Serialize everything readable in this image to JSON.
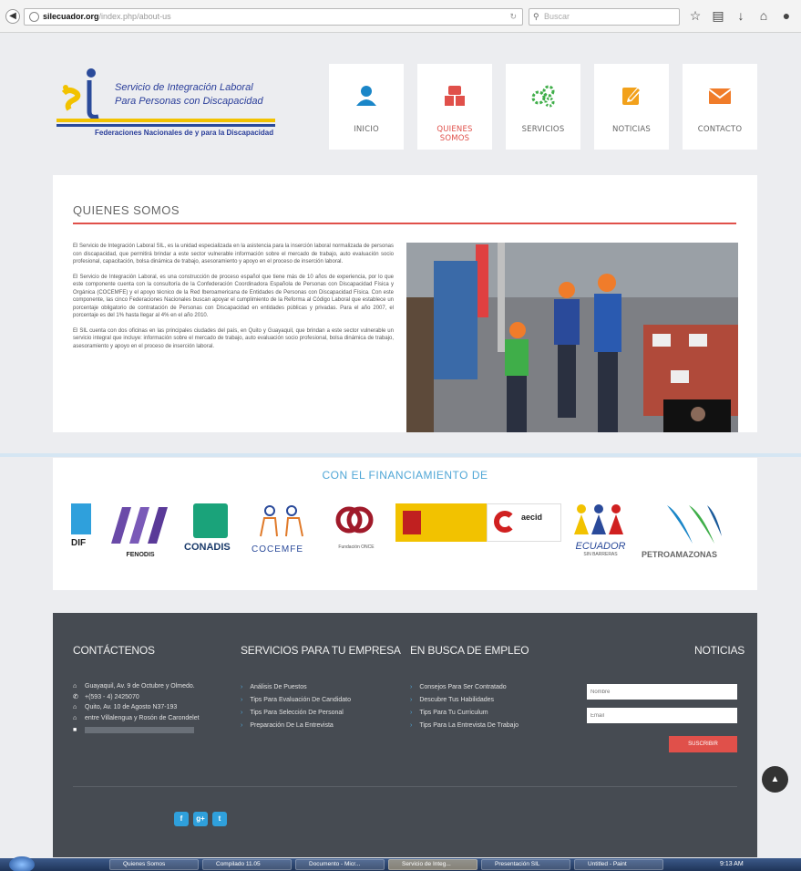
{
  "browser": {
    "url_domain": "silecuador.org",
    "url_path": "/index.php/about-us",
    "search_placeholder": "Buscar"
  },
  "logo": {
    "line1": "Servicio de Integración Laboral",
    "line2": "Para Personas con Discapacidad",
    "line3": "Federaciones Nacionales de y para la Discapacidad"
  },
  "nav": [
    {
      "label": "INICIO",
      "icon": "person-icon",
      "color": "#1a86c8"
    },
    {
      "label": "QUIENES SOMOS",
      "icon": "people-icon",
      "color": "#e0504a"
    },
    {
      "label": "SERVICIOS",
      "icon": "gears-icon",
      "color": "#3fae49"
    },
    {
      "label": "NOTICIAS",
      "icon": "edit-icon",
      "color": "#f2a11b"
    },
    {
      "label": "CONTACTO",
      "icon": "mail-icon",
      "color": "#f07c2a"
    }
  ],
  "about": {
    "title": "QUIENES SOMOS",
    "p1": "El Servicio de Integración Laboral SIL, es la unidad especializada en la asistencia para la inserción laboral normalizada de personas con discapacidad, que permitirá brindar a este sector vulnerable información sobre el mercado de trabajo, auto evaluación socio profesional, capacitación, bolsa dinámica de trabajo, asesoramiento y apoyo en el proceso de inserción laboral.",
    "p2": "El Servicio de Integración Laboral, es una construcción de proceso español que tiene más de 10 años de experiencia, por lo que este componente cuenta con la consultoría de la Confederación Coordinadora Española de Personas con Discapacidad Física y Orgánica (COCEMFE) y el apoyo técnico de la Red Iberoamericana de Entidades de Personas con Discapacidad Física. Con este componente, las cinco Federaciones Nacionales buscan apoyar el cumplimiento de la Reforma al Código Laboral que establece un porcentaje obligatorio de contratación de Personas con Discapacidad en entidades públicas y privadas. Para el año 2007, el porcentaje es del 1% hasta llegar al 4% en el año 2010.",
    "p3": "El SIL cuenta con dos oficinas en las principales ciudades del país, en Quito y Guayaquil, que brindan a este sector vulnerable un servicio integral que incluye: información sobre el mercado de trabajo, auto evaluación socio profesional, bolsa dinámica de trabajo, asesoramiento y apoyo en el proceso de inserción laboral."
  },
  "funding": {
    "title": "CON EL FINANCIAMIENTO DE",
    "sponsors": {
      "fenodis": "FENODIS",
      "conadis": "CONADIS",
      "cocemfe": "COCEMFE",
      "once": "Fundación ONCE",
      "aecid": "aecid",
      "ecuador": "ECUADOR",
      "ecuador_sub": "SIN BARRERAS",
      "petro": "PETROAMAZONAS",
      "dif": "DIF"
    }
  },
  "footer": {
    "contact_title": "CONTÁCTENOS",
    "contact": [
      "Guayaquil, Av. 9 de Octubre y Olmedo.",
      "+(593 - 4) 2425070",
      "Quito, Av. 10 de Agosto N37-193",
      "entre Villalengua y Rosón de Carondelet"
    ],
    "services_title": "SERVICIOS PARA TU EMPRESA",
    "services": [
      "Análisis De Puestos",
      "Tips Para Evaluación De Candidato",
      "Tips Para Selección De Personal",
      "Preparación De La Entrevista"
    ],
    "jobs_title": "EN BUSCA DE EMPLEO",
    "jobs": [
      "Consejos Para Ser Contratado",
      "Descubre Tus Habilidades",
      "Tips Para Tu Curriculum",
      "Tips Para La Entrevista De Trabajo"
    ],
    "news_title": "NOTICIAS",
    "name_placeholder": "Nombre",
    "email_placeholder": "Email",
    "subscribe_label": "SUSCRIBIR",
    "social": [
      "f",
      "g+",
      "t"
    ]
  },
  "taskbar": {
    "tasks": [
      "Quienes Somos",
      "Compilado 11.05",
      "Documento - Micr...",
      "Servicio de Integ...",
      "Presentación SIL",
      "Untitled - Paint"
    ],
    "clock": "9:13 AM"
  }
}
